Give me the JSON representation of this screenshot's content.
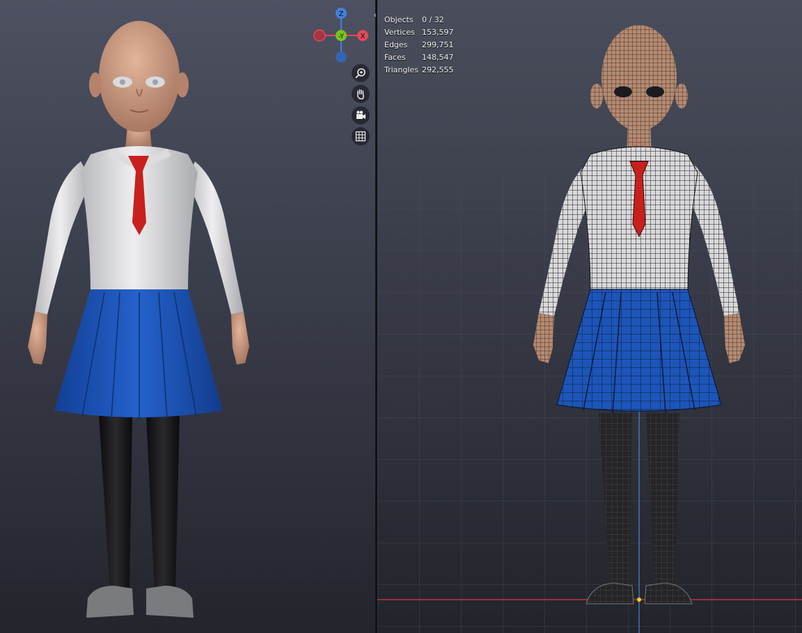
{
  "viewport": {
    "nav_icons": [
      "zoom-icon",
      "hand-pan-icon",
      "camera-icon",
      "grid-ortho-icon"
    ],
    "gizmo": {
      "z_label": "Z",
      "y_label": "-Y",
      "x_label": "X"
    },
    "stats": [
      {
        "label": "Objects",
        "value": "0 / 32"
      },
      {
        "label": "Vertices",
        "value": "153,597"
      },
      {
        "label": "Edges",
        "value": "299,751"
      },
      {
        "label": "Faces",
        "value": "148,547"
      },
      {
        "label": "Triangles",
        "value": "292,555"
      }
    ],
    "colors": {
      "x_axis": "#e24a5a",
      "y_axis": "#7ac21f",
      "z_axis": "#3f82e0",
      "tie": "#c8201c",
      "skirt": "#1d55b8"
    }
  }
}
